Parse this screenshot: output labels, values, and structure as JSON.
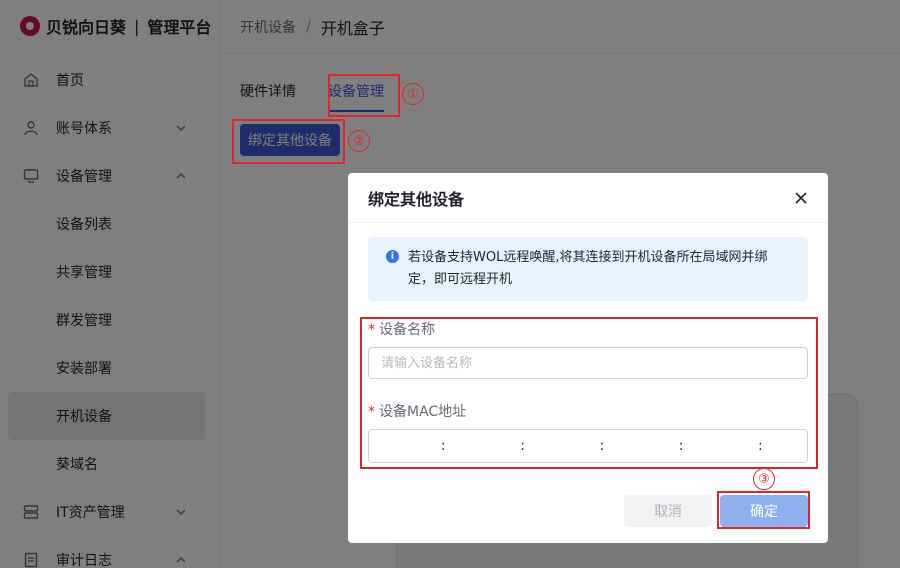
{
  "brand": {
    "name": "贝锐向日葵",
    "separator": "|",
    "product": "管理平台"
  },
  "sidebar": {
    "items": [
      {
        "label": "首页",
        "icon": "home-icon"
      },
      {
        "label": "账号体系",
        "icon": "user-icon",
        "arrow": "chevron-down-icon"
      },
      {
        "label": "设备管理",
        "icon": "monitor-icon",
        "arrow": "chevron-up-icon"
      },
      {
        "label": "IT资产管理",
        "icon": "server-icon",
        "arrow": "chevron-down-icon"
      },
      {
        "label": "审计日志",
        "icon": "document-icon",
        "arrow": "chevron-up-icon"
      }
    ],
    "sub_items": [
      "设备列表",
      "共享管理",
      "群发管理",
      "安装部署",
      "开机设备",
      "葵域名"
    ],
    "active_sub": "开机设备"
  },
  "breadcrumb": {
    "parent": "开机设备",
    "separator": "/",
    "current": "开机盒子"
  },
  "tabs": [
    {
      "label": "硬件详情"
    },
    {
      "label": "设备管理",
      "active": true
    }
  ],
  "bind_button_label": "绑定其他设备",
  "annotations": [
    "①",
    "②",
    "③"
  ],
  "annotation_color": "#e0242c",
  "modal": {
    "title": "绑定其他设备",
    "alert_text": "若设备支持WOL远程唤醒,将其连接到开机设备所在局域网并绑定，即可远程开机",
    "name_label": "设备名称",
    "name_placeholder": "请输入设备名称",
    "mac_label": "设备MAC地址",
    "mac_separator": ":",
    "required_mark": "*",
    "cancel_label": "取消",
    "ok_label": "确定"
  },
  "colors": {
    "primary": "#3b5bdb",
    "brand": "#c8194f",
    "alert_bg": "#e8f1fc",
    "required": "#e0242c"
  }
}
